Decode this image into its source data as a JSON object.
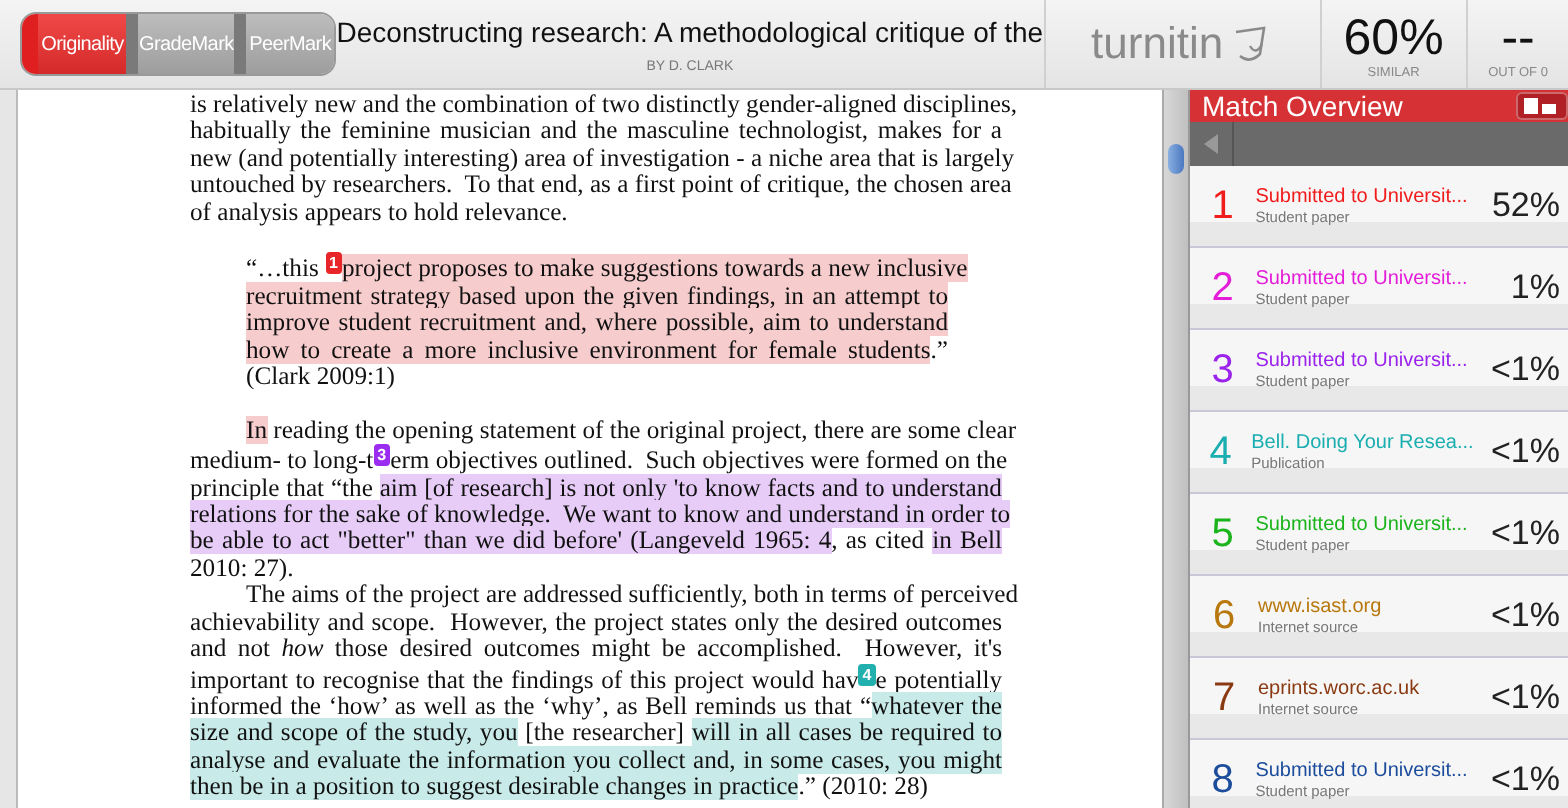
{
  "tabs": [
    {
      "label": "Originality",
      "selected": true
    },
    {
      "label": "GradeMark",
      "selected": false
    },
    {
      "label": "PeerMark",
      "selected": false
    }
  ],
  "document": {
    "title": "Deconstructing research: A methodological critique of the",
    "author": "BY D. CLARK"
  },
  "brand": {
    "name": "turnitin"
  },
  "similarity": {
    "value": "60%",
    "label": "SIMILAR"
  },
  "score": {
    "value": "--",
    "label": "OUT OF 0"
  },
  "paper": [
    {
      "kind": "body",
      "lines": [
        [
          {
            "kind": "text",
            "text": "is relatively new and the combination of two distinctly gender-aligned disciplines,"
          }
        ],
        [
          {
            "kind": "text",
            "text": "habitually the feminine musician and the masculine technologist, makes for a"
          }
        ],
        [
          {
            "kind": "text",
            "text": "new (and potentially interesting) area of investigation - a niche area that is largely"
          }
        ],
        [
          {
            "kind": "text",
            "text": "untouched by researchers.  To that end, as a first point of critique, the chosen area"
          }
        ],
        [
          {
            "kind": "text",
            "text": "of analysis appears to hold relevance."
          }
        ]
      ]
    },
    {
      "kind": "quote",
      "lines": [
        [
          {
            "kind": "text",
            "text": "“…this "
          },
          {
            "kind": "marker",
            "text": "1",
            "color": "#e8262a"
          },
          {
            "kind": "text",
            "text": "project proposes to make suggestions towards a new inclusive",
            "color": "#f6cccd"
          }
        ],
        [
          {
            "kind": "text",
            "text": "recruitment strategy based upon the given findings, in an attempt to",
            "color": "#f6cccd"
          }
        ],
        [
          {
            "kind": "text",
            "text": "improve student recruitment and, where possible, aim to understand",
            "color": "#f6cccd"
          }
        ],
        [
          {
            "kind": "text",
            "text": "how to create a more inclusive environment for female students",
            "color": "#f6cccd"
          },
          {
            "kind": "text",
            "text": ".”"
          }
        ],
        [
          {
            "kind": "text",
            "text": "(Clark 2009:1)"
          }
        ]
      ]
    },
    {
      "kind": "indented",
      "lines": [
        [
          {
            "kind": "text",
            "text": "In",
            "color": "#f6cccd"
          },
          {
            "kind": "text",
            "text": " reading the opening statement of the original project, there are some clear"
          }
        ],
        [
          {
            "kind": "text",
            "text": "medium- to long-t"
          },
          {
            "kind": "marker",
            "text": "3",
            "color": "#9a2cf0"
          },
          {
            "kind": "text",
            "text": "erm objectives outlined.  Such objectives were formed on the"
          }
        ],
        [
          {
            "kind": "text",
            "text": "principle that “the "
          },
          {
            "kind": "text",
            "text": "aim [of research] is not only 'to know facts and to understand",
            "color": "#e6ccf6"
          }
        ],
        [
          {
            "kind": "text",
            "text": "relations for the sake of knowledge.  We want to know and understand in order to",
            "color": "#e6ccf6"
          }
        ],
        [
          {
            "kind": "text",
            "text": "be able to act \"better\" than we did before' (Langeveld 1965: 4",
            "color": "#e6ccf6"
          },
          {
            "kind": "text",
            "text": ", as cited "
          },
          {
            "kind": "text",
            "text": "in Bell",
            "color": "#e6ccf6"
          }
        ],
        [
          {
            "kind": "text",
            "text": "2010: 27)."
          }
        ]
      ]
    },
    {
      "kind": "indented",
      "lines": [
        [
          {
            "kind": "text",
            "text": "The aims of the project are addressed sufficiently, both in terms of perceived"
          }
        ],
        [
          {
            "kind": "text",
            "text": "achievability and scope.  However, the project states only the desired outcomes"
          }
        ],
        [
          {
            "kind": "text",
            "text": "and not *how* those desired outcomes might be accomplished.  However, it's"
          }
        ],
        [
          {
            "kind": "text",
            "text": "important to recognise that the findings of this project would hav"
          },
          {
            "kind": "marker",
            "text": "4",
            "color": "#22b0ae"
          },
          {
            "kind": "text",
            "text": "e potentially"
          }
        ],
        [
          {
            "kind": "text",
            "text": "informed the ‘how’ as well as the ‘why’, as Bell reminds us that “"
          },
          {
            "kind": "text",
            "text": "whatever the",
            "color": "#c8eae8"
          }
        ],
        [
          {
            "kind": "text",
            "text": "size and scope of the study, you",
            "color": "#c8eae8"
          },
          {
            "kind": "text",
            "text": " [the researcher] "
          },
          {
            "kind": "text",
            "text": "will in all cases be required to",
            "color": "#c8eae8"
          }
        ],
        [
          {
            "kind": "text",
            "text": "analyse and evaluate the information you collect and, in some cases, you might",
            "color": "#c8eae8"
          }
        ],
        [
          {
            "kind": "text",
            "text": "then be in a position to suggest desirable changes in practice",
            "color": "#c8eae8"
          },
          {
            "kind": "text",
            "text": ".” (2010: 28)"
          }
        ]
      ]
    }
  ],
  "panel": {
    "title": "Match Overview"
  },
  "matches": [
    {
      "number": "1",
      "title": "Submitted to Universit...",
      "type": "Student paper",
      "percent": "52%",
      "color": "#f01c1c"
    },
    {
      "number": "2",
      "title": "Submitted to Universit...",
      "type": "Student paper",
      "percent": "1%",
      "color": "#e41ed8"
    },
    {
      "number": "3",
      "title": "Submitted to Universit...",
      "type": "Student paper",
      "percent": "<1%",
      "color": "#9a22ec"
    },
    {
      "number": "4",
      "title": "Bell. Doing Your Resea...",
      "type": "Publication",
      "percent": "<1%",
      "color": "#1aaeb0"
    },
    {
      "number": "5",
      "title": "Submitted to Universit...",
      "type": "Student paper",
      "percent": "<1%",
      "color": "#1cb41c"
    },
    {
      "number": "6",
      "title": "www.isast.org",
      "type": "Internet source",
      "percent": "<1%",
      "color": "#b8780e"
    },
    {
      "number": "7",
      "title": "eprints.worc.ac.uk",
      "type": "Internet source",
      "percent": "<1%",
      "color": "#8a3a12"
    },
    {
      "number": "8",
      "title": "Submitted to Universit...",
      "type": "Student paper",
      "percent": "<1%",
      "color": "#1c4c9c"
    }
  ]
}
